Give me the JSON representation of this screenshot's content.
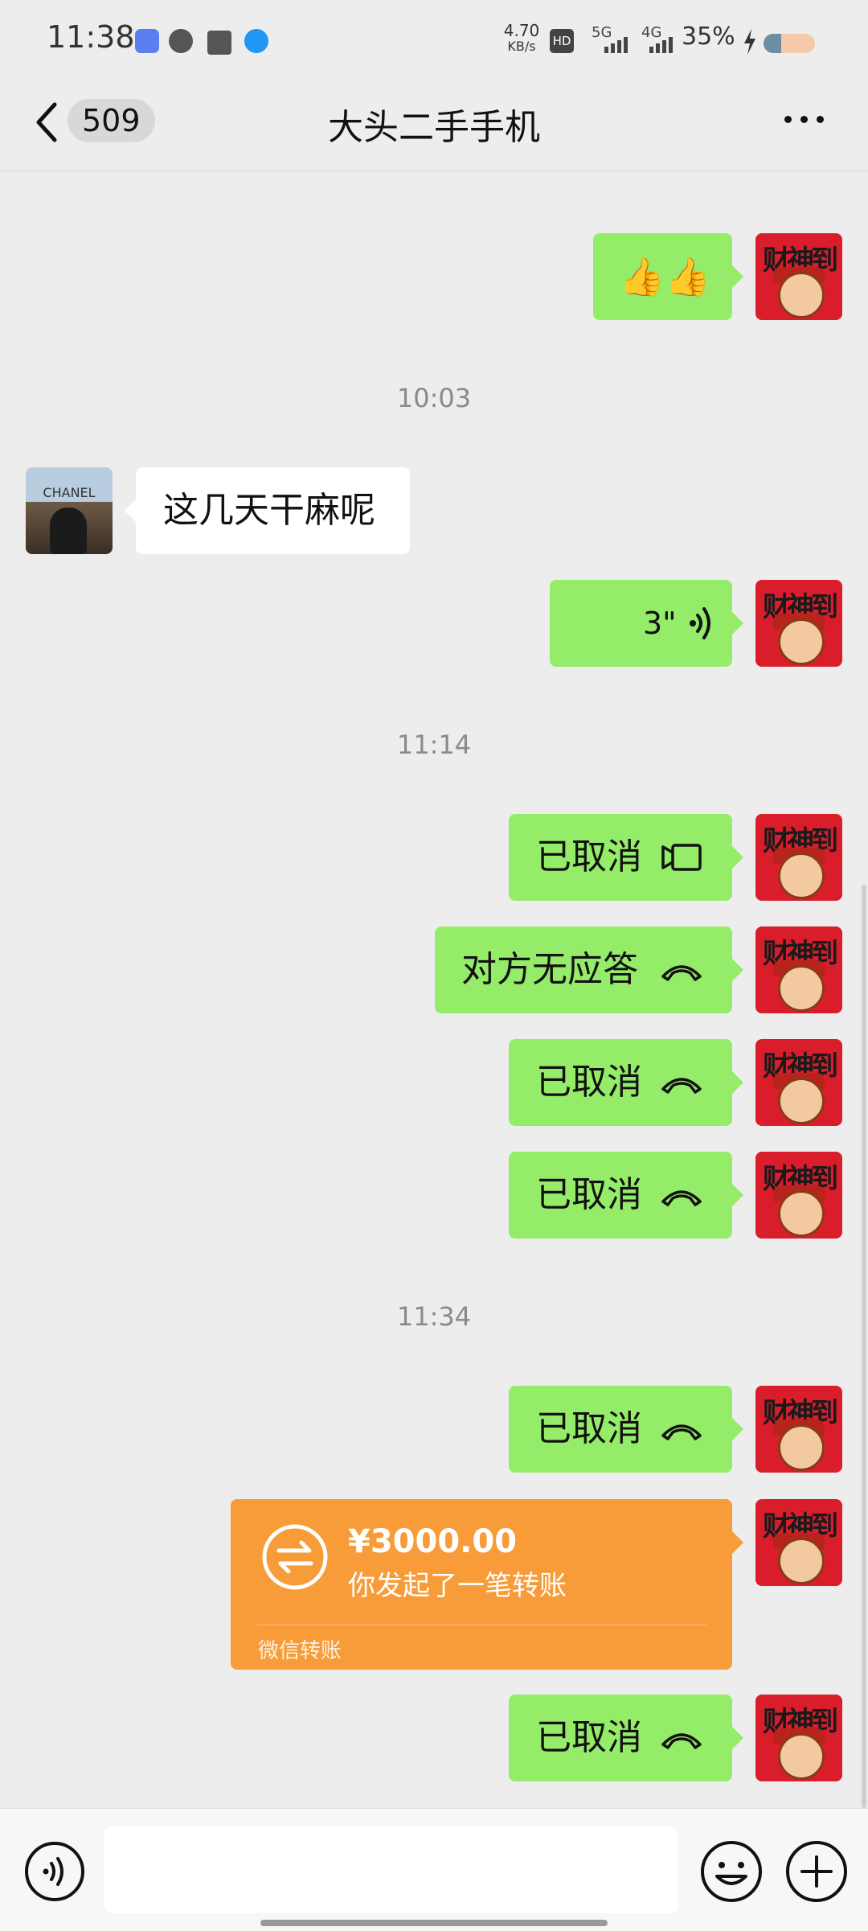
{
  "status_bar": {
    "time": "11:38",
    "net_speed": "4.70\nKB/s",
    "net_speed_value": "4.70",
    "net_speed_unit": "KB/s",
    "hd": "HD",
    "sig5g": "5G",
    "sig4g": "4G",
    "battery": "35%",
    "battery_level": 0.35
  },
  "header": {
    "unread_count": "509",
    "title": "大头二手手机"
  },
  "messages": {
    "ts1": "10:03",
    "ts2": "11:14",
    "ts3": "11:34",
    "emoji_msg": "👍👍",
    "in_text": "这几天干麻呢",
    "voice_duration": "3\"",
    "video_cancel": "已取消",
    "no_answer": "对方无应答",
    "cancel2": "已取消",
    "cancel3": "已取消",
    "cancel4": "已取消",
    "cancel5": "已取消",
    "self_avatar_text": "财神到",
    "other_avatar_text": "CHANEL"
  },
  "transfer": {
    "amount": "¥3000.00",
    "description": "你发起了一笔转账",
    "footer": "微信转账"
  },
  "input": {
    "placeholder": ""
  },
  "colors": {
    "bubble_out": "#95ec69",
    "transfer": "#f79c38",
    "background": "#ededed"
  }
}
